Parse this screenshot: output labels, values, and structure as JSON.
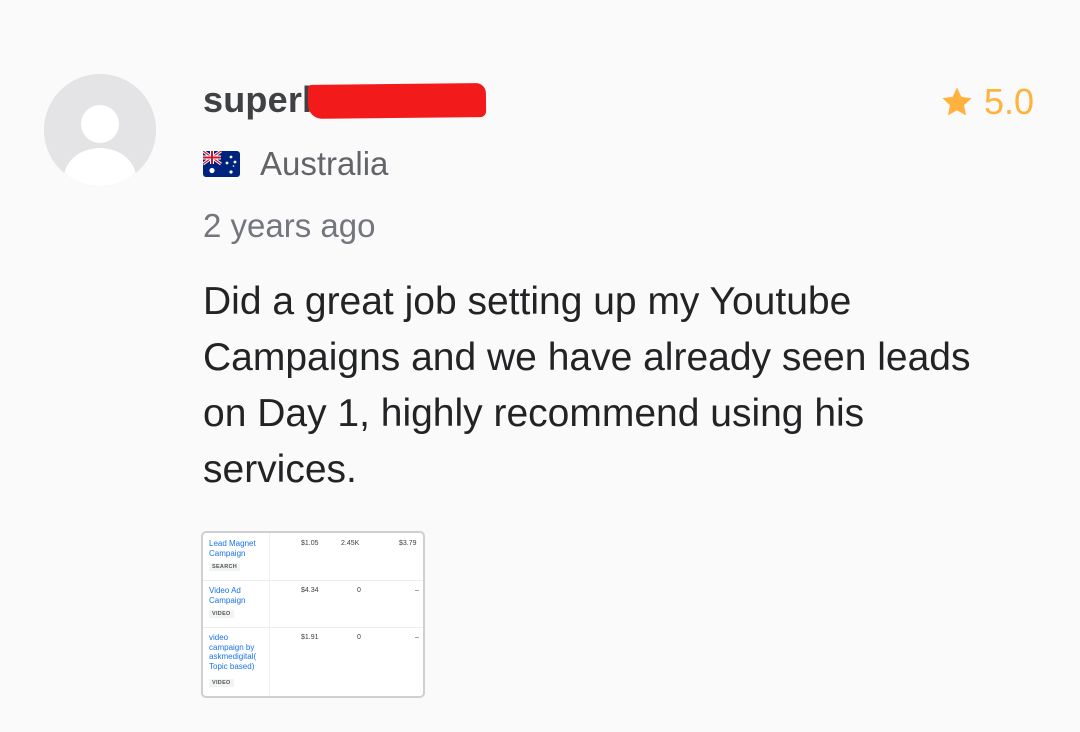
{
  "reviewer": {
    "username": "superl",
    "country": "Australia",
    "time_ago": "2 years ago"
  },
  "rating": {
    "value": "5.0",
    "color": "#ffb33e"
  },
  "review": {
    "text": "Did a great job setting up my Youtube Campaigns and we have already seen leads on Day 1, highly recommend using his services."
  },
  "attachment": {
    "rows": [
      {
        "name": "Lead Magnet Campaign",
        "type": "SEARCH",
        "col_a": "$1.05",
        "col_b": "2.45K",
        "col_c": "$3.79"
      },
      {
        "name": "Video Ad Campaign",
        "type": "VIDEO",
        "col_a": "$4.34",
        "col_b": "0",
        "col_c": "–"
      },
      {
        "name": "video campaign by askmedigital( Topic based)",
        "type": "VIDEO",
        "col_a": "$1.91",
        "col_b": "0",
        "col_c": "–"
      }
    ]
  },
  "icons": {
    "avatar": "default-user-avatar-icon",
    "star": "star-icon",
    "flag": "australia-flag-icon"
  }
}
